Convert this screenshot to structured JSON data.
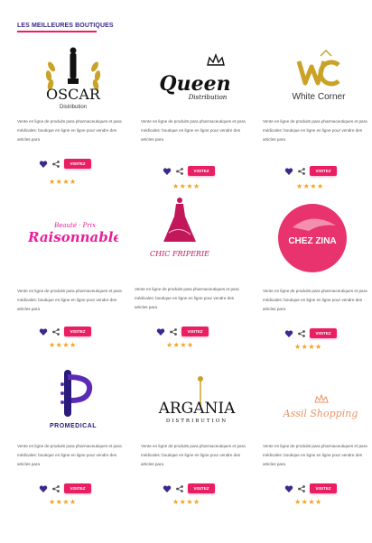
{
  "section": {
    "title": "LES MEILLEURES BOUTIQUES"
  },
  "colors": {
    "accent": "#e91e63",
    "title": "#3b2a8c",
    "star": "#f4a21f",
    "heart": "#3b2a8c"
  },
  "shops": [
    {
      "name": "OSCAR",
      "sub": "Distribution",
      "desc": "Vente en ligne de produits para pharmaceutiques et para médicales: boutique en ligne en ligne pour vendre des articles para",
      "visit": "VISITEZ",
      "rating": "★★★★",
      "logo_icon": "oscar-trophy-icon"
    },
    {
      "name": "Queen",
      "sub": "Distribution",
      "desc": "Vente en ligne de produits para pharmaceutiques et para médicales: boutique en ligne en ligne pour vendre des articles para",
      "visit": "VISITEZ",
      "rating": "★★★★",
      "logo_icon": "crown-icon"
    },
    {
      "name": "White Corner",
      "sub": "",
      "desc": "Vente en ligne de produits para pharmaceutiques et para médicales: boutique en ligne en ligne pour vendre des articles para",
      "visit": "VISITEZ",
      "rating": "★★★★",
      "logo_icon": "wc-monogram-icon"
    },
    {
      "name": "Raisonnable",
      "sub": "Beauté · Prix",
      "desc": "Vente en ligne de produits para pharmaceutiques et para médicales: boutique en ligne en ligne pour vendre des articles para",
      "visit": "VISITEZ",
      "rating": "★★★★",
      "logo_icon": "raisonnable-script-icon"
    },
    {
      "name": "CHIC FRIPERIE",
      "sub": "",
      "desc": "Vente en ligne de produits para pharmaceutiques et para médicales: boutique en ligne en ligne pour vendre des articles para",
      "visit": "VISITEZ",
      "rating": "★★★★",
      "logo_icon": "dress-icon"
    },
    {
      "name": "CHEZ ZINA",
      "sub": "",
      "desc": "Vente en ligne de produits para pharmaceutiques et para médicales: boutique en ligne en ligne pour vendre des articles para",
      "visit": "VISITEZ",
      "rating": "★★★★",
      "logo_icon": "hat-lady-icon"
    },
    {
      "name": "PROMEDICAL",
      "sub": "",
      "desc": "Vente en ligne de produits para pharmaceutiques et para médicales: boutique en ligne en ligne pour vendre des articles para",
      "visit": "VISITEZ",
      "rating": "★★★★",
      "logo_icon": "p-monogram-icon"
    },
    {
      "name": "ARGANIA",
      "sub": "DISTRIBUTION",
      "desc": "Vente en ligne de produits para pharmaceutiques et para médicales: boutique en ligne en ligne pour vendre des articles para",
      "visit": "VISITEZ",
      "rating": "★★★★",
      "logo_icon": "argan-tree-icon"
    },
    {
      "name": "Assil Shopping",
      "sub": "",
      "desc": "Vente en ligne de produits para pharmaceutiques et para médicales: boutique en ligne en ligne pour vendre des articles para",
      "visit": "VISITEZ",
      "rating": "★★★★",
      "logo_icon": "small-crown-icon"
    }
  ]
}
